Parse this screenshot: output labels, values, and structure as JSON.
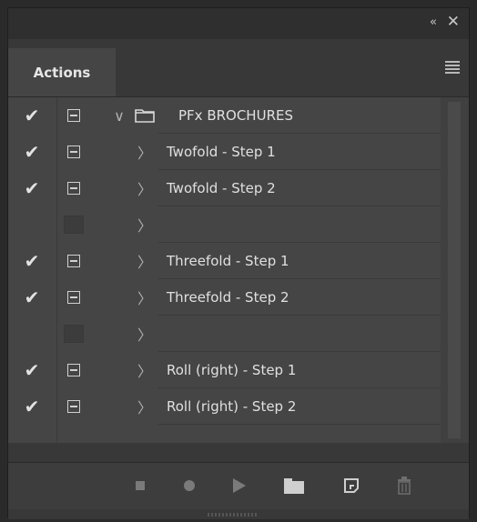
{
  "panel": {
    "tab_label": "Actions",
    "collapse_glyph": "«",
    "close_glyph": "✕"
  },
  "rows": [
    {
      "checked": true,
      "dialog": true,
      "expanded": true,
      "is_set": true,
      "label": "PFx BROCHURES"
    },
    {
      "checked": true,
      "dialog": true,
      "expanded": false,
      "is_set": false,
      "label": "Twofold - Step 1"
    },
    {
      "checked": true,
      "dialog": true,
      "expanded": false,
      "is_set": false,
      "label": "Twofold - Step 2"
    },
    {
      "checked": false,
      "dialog": false,
      "expanded": false,
      "is_set": false,
      "label": ""
    },
    {
      "checked": true,
      "dialog": true,
      "expanded": false,
      "is_set": false,
      "label": "Threefold - Step 1"
    },
    {
      "checked": true,
      "dialog": true,
      "expanded": false,
      "is_set": false,
      "label": "Threefold - Step 2"
    },
    {
      "checked": false,
      "dialog": false,
      "expanded": false,
      "is_set": false,
      "label": ""
    },
    {
      "checked": true,
      "dialog": true,
      "expanded": false,
      "is_set": false,
      "label": "Roll (right) - Step 1"
    },
    {
      "checked": true,
      "dialog": true,
      "expanded": false,
      "is_set": false,
      "label": "Roll (right) - Step 2"
    }
  ],
  "glyphs": {
    "check": "✔",
    "chevron_right": "〉",
    "chevron_down": "∨"
  },
  "footer_icons": [
    "stop-icon",
    "record-icon",
    "play-icon",
    "new-set-folder-icon",
    "new-action-icon",
    "delete-trash-icon"
  ]
}
